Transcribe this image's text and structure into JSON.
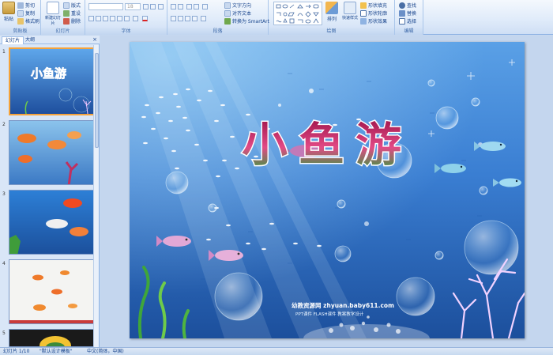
{
  "ribbon": {
    "clipboard": {
      "label": "剪贴板",
      "paste": "粘贴",
      "cut": "剪切",
      "copy": "复制",
      "format_painter": "格式刷"
    },
    "slides": {
      "label": "幻灯片",
      "new_slide": "新建幻灯片",
      "layout": "版式",
      "reset": "重设",
      "delete": "删除"
    },
    "font": {
      "label": "字体",
      "size_value": "18"
    },
    "paragraph": {
      "label": "段落",
      "text_direction": "文字方向",
      "align_text": "对齐文本",
      "smartart": "转换为 SmartArt"
    },
    "drawing": {
      "label": "绘图",
      "arrange": "排列",
      "quick_styles": "快速样式",
      "shape_fill": "形状填充",
      "shape_outline": "形状轮廓",
      "shape_effects": "形状效果"
    },
    "editing": {
      "label": "编辑",
      "find": "查找",
      "replace": "替换",
      "select": "选择"
    }
  },
  "panel": {
    "tab_slides": "幻灯片",
    "tab_outline": "大纲",
    "close": "×",
    "thumbnails": [
      {
        "num": "1",
        "caption": "小鱼游"
      },
      {
        "num": "2"
      },
      {
        "num": "3"
      },
      {
        "num": "4"
      },
      {
        "num": "5"
      }
    ]
  },
  "slide": {
    "title": "小鱼游",
    "watermark_main": "幼教资源网 zhyuan.baby611.com",
    "watermark_sub": "PPT课件 FLASH课件 教案教学设计"
  },
  "status": {
    "slide_counter": "幻灯片 1/10",
    "theme": "\"默认设计模板\"",
    "language": "中文(简体，中国)"
  },
  "colors": {
    "ribbon_bg": "#dfeaf8",
    "selection": "#f5a33b",
    "ocean_top": "#5aa0e6",
    "ocean_bottom": "#1c4f9c"
  }
}
